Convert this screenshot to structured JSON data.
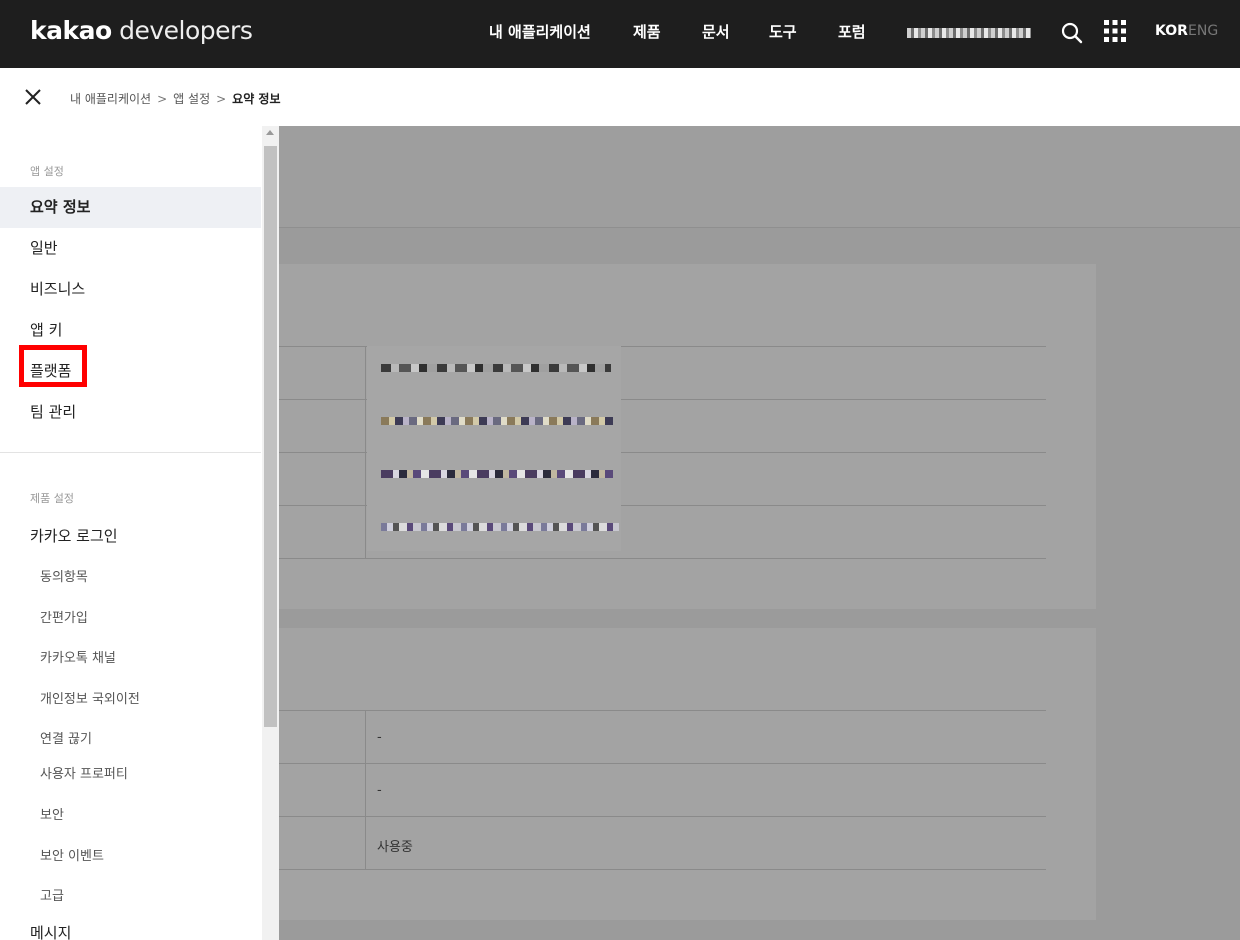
{
  "header": {
    "logo_bold": "kakao",
    "logo_regular": " developers",
    "nav": [
      "내 애플리케이션",
      "제품",
      "문서",
      "도구",
      "포럼"
    ],
    "lang_active": "KOR",
    "lang_inactive": "ENG"
  },
  "breadcrumb": {
    "items": [
      "내 애플리케이션",
      "앱 설정",
      "요약 정보"
    ],
    "separator": ">"
  },
  "sidebar": {
    "app_section_label": "앱 설정",
    "app_items": [
      "요약 정보",
      "일반",
      "비즈니스",
      "앱 키",
      "플랫폼",
      "팀 관리"
    ],
    "active_item": "요약 정보",
    "highlighted_item": "플랫폼",
    "product_section_label": "제품 설정",
    "product_group": "카카오 로그인",
    "product_sub_items": [
      "동의항목",
      "간편가입",
      "카카오톡 채널",
      "개인정보 국외이전",
      "연결 끊기",
      "사용자 프로퍼티",
      "보안",
      "보안 이벤트",
      "고급"
    ],
    "next_group": "메시지"
  },
  "main": {
    "card2_values": [
      "-",
      "-",
      "사용중"
    ]
  },
  "colors": {
    "nav_bg": "#1e1e1e",
    "highlight_border": "#ff0000",
    "active_item_bg": "#eef0f4"
  },
  "icons": [
    "close-icon",
    "search-icon",
    "apps-grid-icon",
    "scroll-up-icon"
  ]
}
